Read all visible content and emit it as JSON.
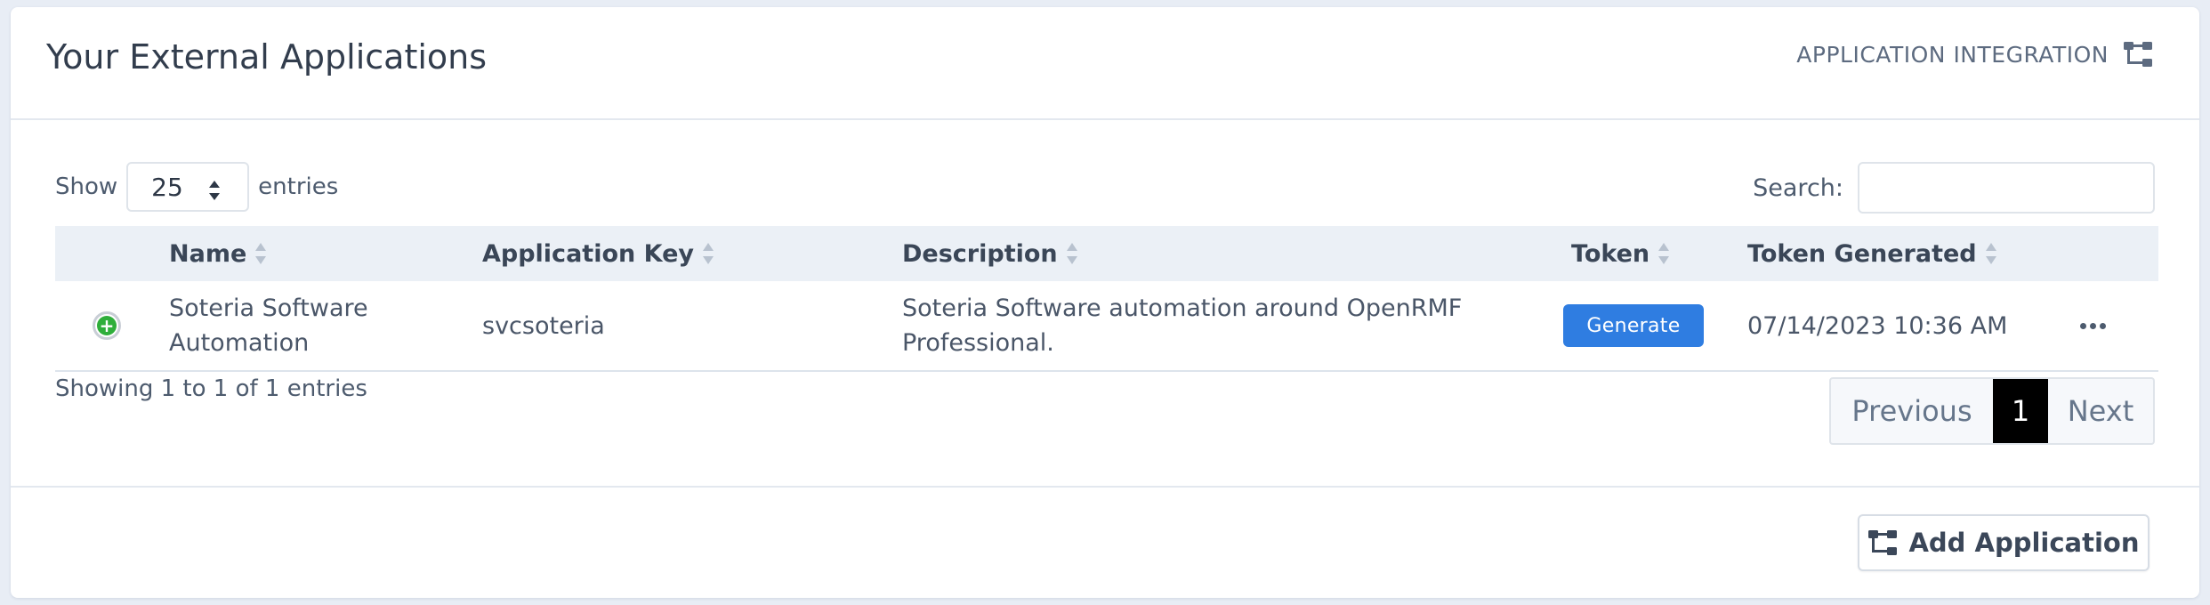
{
  "header": {
    "title": "Your External Applications",
    "integration_label": "APPLICATION INTEGRATION",
    "integration_icon": "sitemap-icon"
  },
  "length_menu": {
    "prefix": "Show",
    "value": "25",
    "suffix": "entries"
  },
  "search": {
    "label": "Search:",
    "value": "",
    "placeholder": ""
  },
  "table": {
    "columns": [
      "",
      "Name",
      "Application Key",
      "Description",
      "Token",
      "Token Generated",
      ""
    ],
    "rows": [
      {
        "name_line1": "Soteria Software",
        "name_line2": "Automation",
        "application_key": "svcsoteria",
        "description_line1": "Soteria Software automation around OpenRMF",
        "description_line2": "Professional.",
        "token_button": "Generate",
        "token_generated": "07/14/2023 10:36 AM"
      }
    ]
  },
  "info": "Showing 1 to 1 of 1 entries",
  "pagination": {
    "previous": "Previous",
    "current": "1",
    "next": "Next"
  },
  "footer": {
    "add_button": "Add Application"
  },
  "colors": {
    "accent": "#2f7de1",
    "expand_green": "#2fae3b",
    "header_bg": "#ebf0f6"
  }
}
